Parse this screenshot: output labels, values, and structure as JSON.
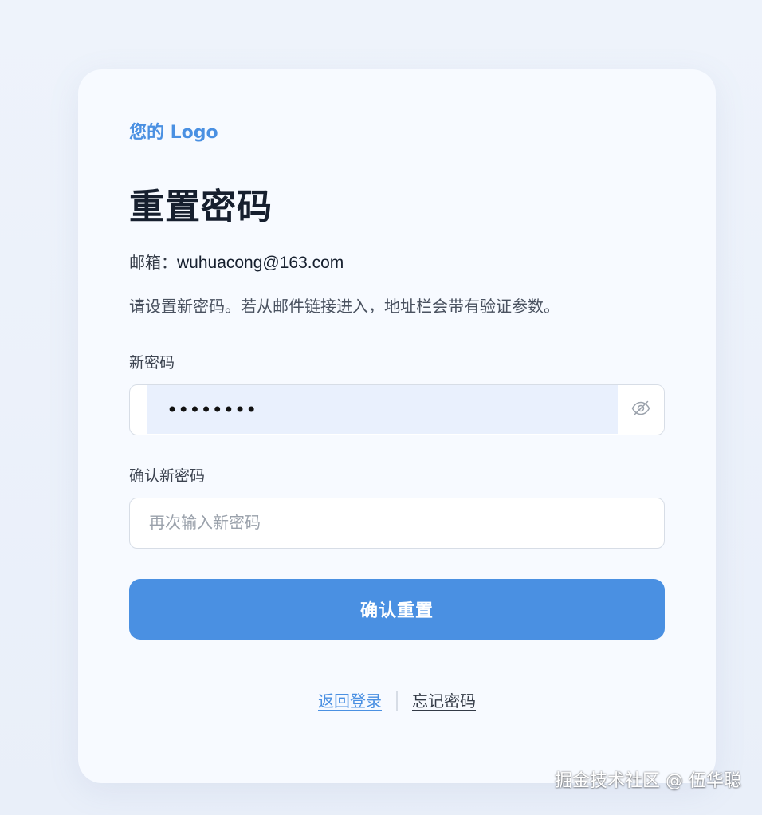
{
  "brand": {
    "logo_text": "您的 Logo",
    "accent_color": "#4a90e2"
  },
  "page": {
    "title": "重置密码",
    "email_label": "邮箱：",
    "email_value": "wuhuacong@163.com",
    "description": "请设置新密码。若从邮件链接进入，地址栏会带有验证参数。"
  },
  "form": {
    "new_password": {
      "label": "新密码",
      "value_masked": "••••••••",
      "visibility_icon": "eye-off-icon"
    },
    "confirm_password": {
      "label": "确认新密码",
      "placeholder": "再次输入新密码",
      "value": ""
    },
    "submit_label": "确认重置"
  },
  "links": {
    "back_to_login": "返回登录",
    "forgot_password": "忘记密码"
  },
  "watermark": "掘金技术社区 @ 伍华聪"
}
